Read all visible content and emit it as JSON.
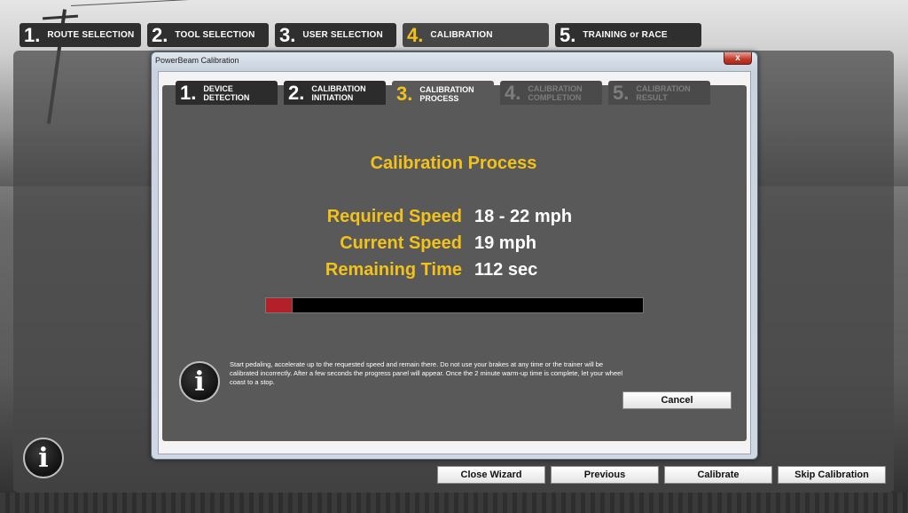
{
  "top_steps": [
    {
      "num": "1.",
      "label": "ROUTE SELECTION"
    },
    {
      "num": "2.",
      "label": "TOOL SELECTION"
    },
    {
      "num": "3.",
      "label": "USER SELECTION"
    },
    {
      "num": "4.",
      "label": "CALIBRATION"
    },
    {
      "num": "5.",
      "label": "TRAINING or RACE"
    }
  ],
  "dialog": {
    "title": "PowerBeam Calibration",
    "close": "x",
    "tabs": [
      {
        "num": "1.",
        "line1": "DEVICE",
        "line2": "DETECTION"
      },
      {
        "num": "2.",
        "line1": "CALIBRATION",
        "line2": "INITIATION"
      },
      {
        "num": "3.",
        "line1": "CALIBRATION",
        "line2": "PROCESS"
      },
      {
        "num": "4.",
        "line1": "CALIBRATION",
        "line2": "COMPLETION"
      },
      {
        "num": "5.",
        "line1": "CALIBRATION",
        "line2": "RESULT"
      }
    ],
    "heading": "Calibration Process",
    "metrics": {
      "required_label": "Required Speed",
      "required_value": "18 - 22 mph",
      "current_label": "Current Speed",
      "current_value": "19 mph",
      "remaining_label": "Remaining Time",
      "remaining_value": "112 sec"
    },
    "progress_fraction": 0.07,
    "progress_color": "#b3202a",
    "info_icon_glyph": "i",
    "help_text": "Start pedaling, accelerate up to the requested speed and remain there.  Do not use your brakes at any time or the trainer will be calibrated incorrectly. After a few seconds the progress panel will appear.  Once the 2 minute warm-up time is complete, let your wheel coast to a stop.",
    "cancel_label": "Cancel"
  },
  "footer": {
    "info_icon_glyph": "i",
    "buttons": [
      "Close Wizard",
      "Previous",
      "Calibrate",
      "Skip Calibration"
    ]
  },
  "colors": {
    "accent": "#f2c21b",
    "panel": "#595959"
  }
}
